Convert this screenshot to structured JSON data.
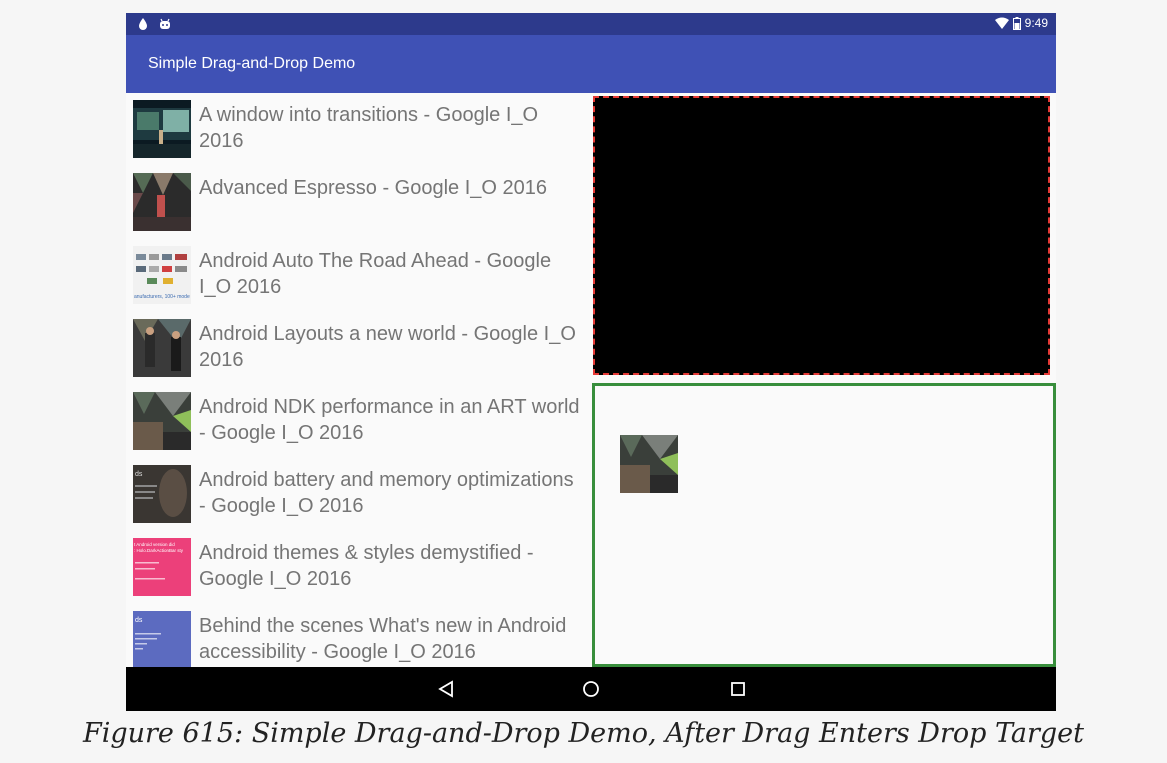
{
  "status_bar": {
    "time": "9:49"
  },
  "app_bar": {
    "title": "Simple Drag-and-Drop Demo"
  },
  "list": {
    "items": [
      {
        "label": "A window into transitions - Google I_O 2016",
        "thumb": "stage-talk-thumbnail"
      },
      {
        "label": "Advanced Espresso - Google I_O 2016",
        "thumb": "stage-talk-thumbnail"
      },
      {
        "label": "Android Auto The Road Ahead - Google I_O 2016",
        "thumb": "car-logos-slide-thumbnail",
        "thumb_text": "anufacturers, 100+ mode"
      },
      {
        "label": "Android Layouts a new world - Google I_O 2016",
        "thumb": "two-speakers-thumbnail"
      },
      {
        "label": "Android NDK performance in an ART world - Google I_O 2016",
        "thumb": "stage-talk-thumbnail"
      },
      {
        "label": "Android battery and memory optimizations - Google I_O 2016",
        "thumb": "dark-slide-thumbnail",
        "thumb_text": "ds"
      },
      {
        "label": "Android themes & styles demystified - Google I_O 2016",
        "thumb": "pink-slide-thumbnail",
        "thumb_text": "t Android version did\n: Holo.DarkActionBar sty"
      },
      {
        "label": "Behind the scenes What's new in Android accessibility - Google I_O 2016",
        "thumb": "blue-slide-thumbnail",
        "thumb_text": "ds"
      }
    ]
  },
  "nav_bar": {
    "back": "back-icon",
    "home": "home-icon",
    "recents": "recents-icon"
  },
  "colors": {
    "status_bar": "#2d3a8c",
    "app_bar": "#3f51b5",
    "drop_target_border_active": "#388e3c",
    "drag_source_border": "#e53935"
  },
  "caption": "Figure 615: Simple Drag-and-Drop Demo, After Drag Enters Drop Target"
}
